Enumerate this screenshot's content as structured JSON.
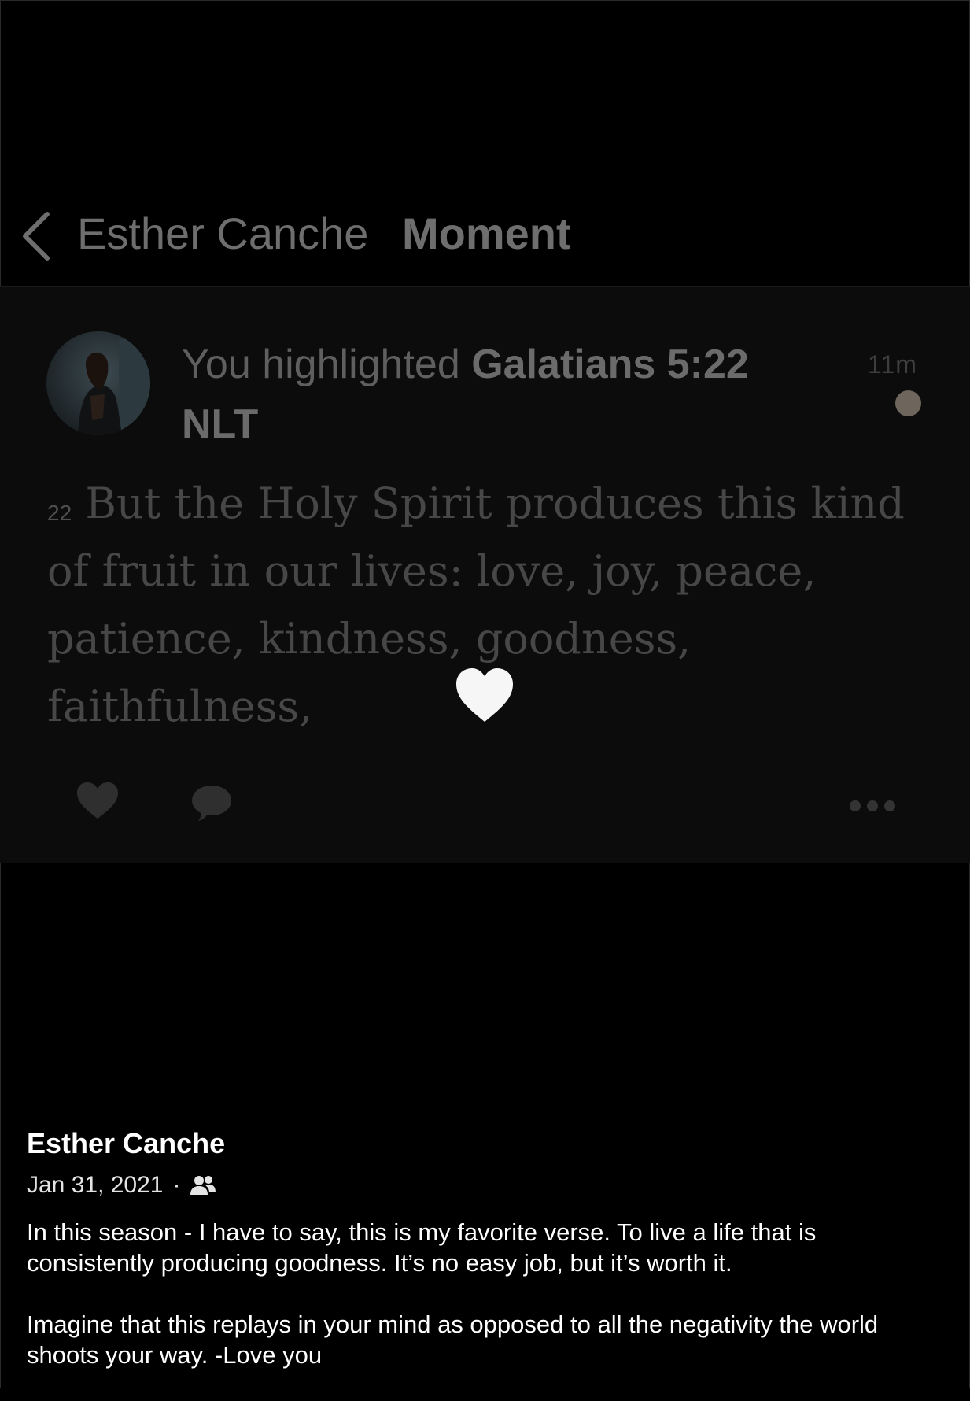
{
  "nav": {
    "author": "Esther Canche",
    "title": "Moment"
  },
  "moment": {
    "headline_prefix": "You highlighted",
    "reference": "Galatians 5:22",
    "version": "NLT",
    "time": "11m",
    "verse_number": "22",
    "verse_text": "But the Holy Spirit produces this kind of fruit in our lives: love, joy, peace, patience, kindness, goodness, faithfulness,"
  },
  "caption": {
    "author": "Esther Canche",
    "date": "Jan 31, 2021",
    "separator": "·",
    "paragraphs": [
      "In this season - I have to say, this is my favorite verse. To live a life that is consistently producing goodness. It’s no easy job, but it’s worth it.",
      "Imagine that this replays in your mind as opposed to all the negativity the world shoots your way. -Love you"
    ]
  },
  "icons": {
    "back": "chevron-left-icon",
    "like": "heart-icon",
    "comment": "comment-bubble-icon",
    "more": "more-dots-icon",
    "audience": "friends-icon",
    "overlay": "white-heart-icon"
  },
  "colors": {
    "background": "#000000",
    "card": "#0c0c0c",
    "dimmed_text": "#5f5f5f",
    "unread_dot": "#6e665d"
  }
}
